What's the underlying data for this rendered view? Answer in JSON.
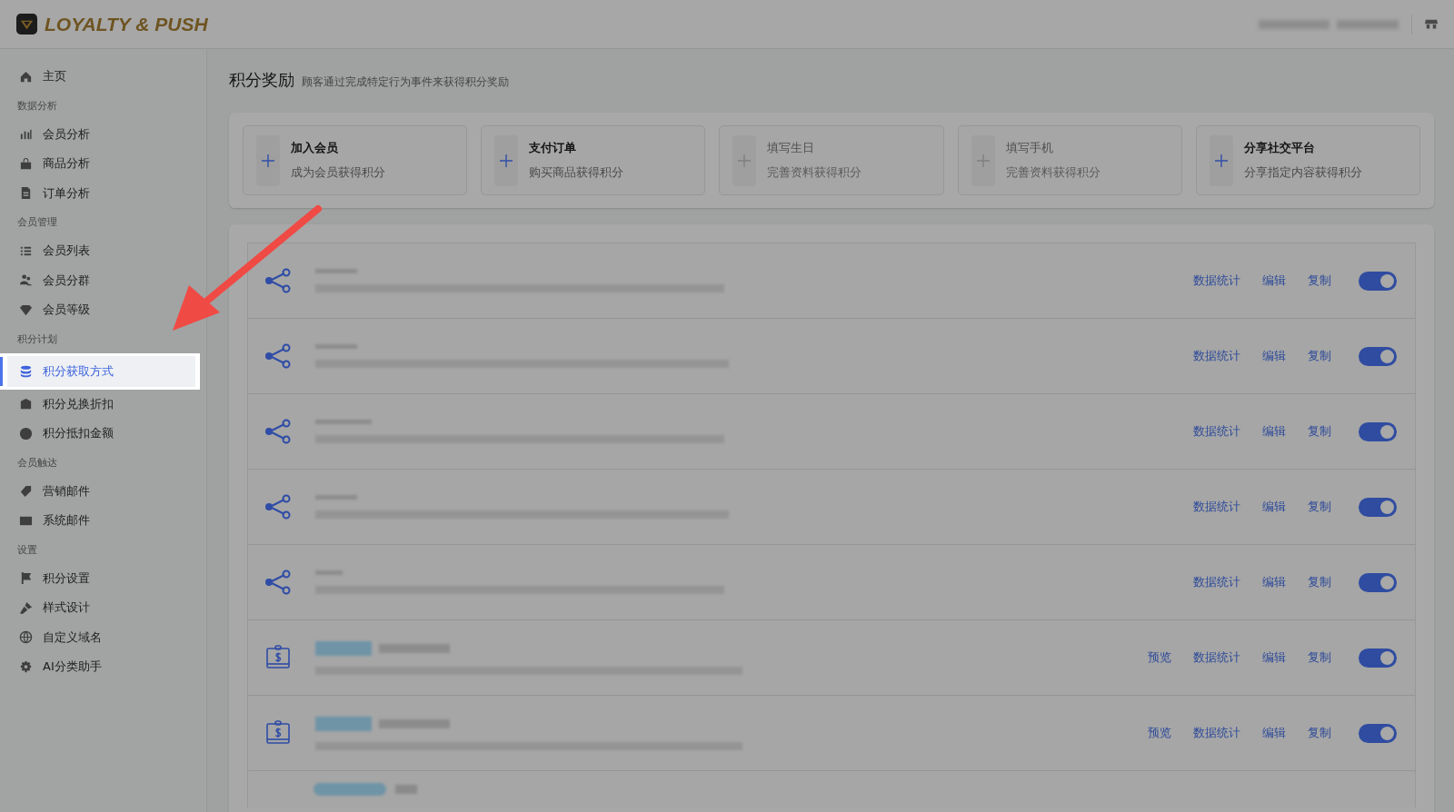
{
  "header": {
    "brand": "LOYALTY & PUSH"
  },
  "sidebar": {
    "sections": [
      {
        "items": [
          {
            "label": "主页",
            "selected": false
          }
        ]
      },
      {
        "title": "数据分析",
        "items": [
          {
            "label": "会员分析",
            "selected": false
          },
          {
            "label": "商品分析",
            "selected": false
          },
          {
            "label": "订单分析",
            "selected": false
          }
        ]
      },
      {
        "title": "会员管理",
        "items": [
          {
            "label": "会员列表",
            "selected": false
          },
          {
            "label": "会员分群",
            "selected": false
          },
          {
            "label": "会员等级",
            "selected": false
          }
        ]
      },
      {
        "title": "积分计划",
        "items": [
          {
            "label": "积分获取方式",
            "selected": true
          },
          {
            "label": "积分兑换折扣",
            "selected": false
          },
          {
            "label": "积分抵扣金额",
            "selected": false
          }
        ]
      },
      {
        "title": "会员触达",
        "items": [
          {
            "label": "营销邮件",
            "selected": false
          },
          {
            "label": "系统邮件",
            "selected": false
          }
        ]
      },
      {
        "title": "设置",
        "items": [
          {
            "label": "积分设置",
            "selected": false
          },
          {
            "label": "样式设计",
            "selected": false
          },
          {
            "label": "自定义域名",
            "selected": false
          },
          {
            "label": "AI分类助手",
            "selected": false
          }
        ]
      }
    ]
  },
  "page": {
    "title": "积分奖励",
    "subtitle": "顾客通过完成特定行为事件来获得积分奖励"
  },
  "events": [
    {
      "title": "加入会员",
      "description": "成为会员获得积分",
      "disabled": false
    },
    {
      "title": "支付订单",
      "description": "购买商品获得积分",
      "disabled": false
    },
    {
      "title": "填写生日",
      "description": "完善资料获得积分",
      "disabled": true
    },
    {
      "title": "填写手机",
      "description": "完善资料获得积分",
      "disabled": true
    },
    {
      "title": "分享社交平台",
      "description": "分享指定内容获得积分",
      "disabled": false
    }
  ],
  "rules": [
    {
      "kind": "share",
      "actions": [
        "数据统计",
        "编辑",
        "复制"
      ],
      "on": true
    },
    {
      "kind": "share",
      "actions": [
        "数据统计",
        "编辑",
        "复制"
      ],
      "on": true
    },
    {
      "kind": "share",
      "actions": [
        "数据统计",
        "编辑",
        "复制"
      ],
      "on": true
    },
    {
      "kind": "share",
      "actions": [
        "数据统计",
        "编辑",
        "复制"
      ],
      "on": true
    },
    {
      "kind": "share",
      "actions": [
        "数据统计",
        "编辑",
        "复制"
      ],
      "on": true
    },
    {
      "kind": "voucher",
      "actions": [
        "预览",
        "数据统计",
        "编辑",
        "复制"
      ],
      "on": true
    },
    {
      "kind": "voucher",
      "actions": [
        "预览",
        "数据统计",
        "编辑",
        "复制"
      ],
      "on": true
    }
  ]
}
